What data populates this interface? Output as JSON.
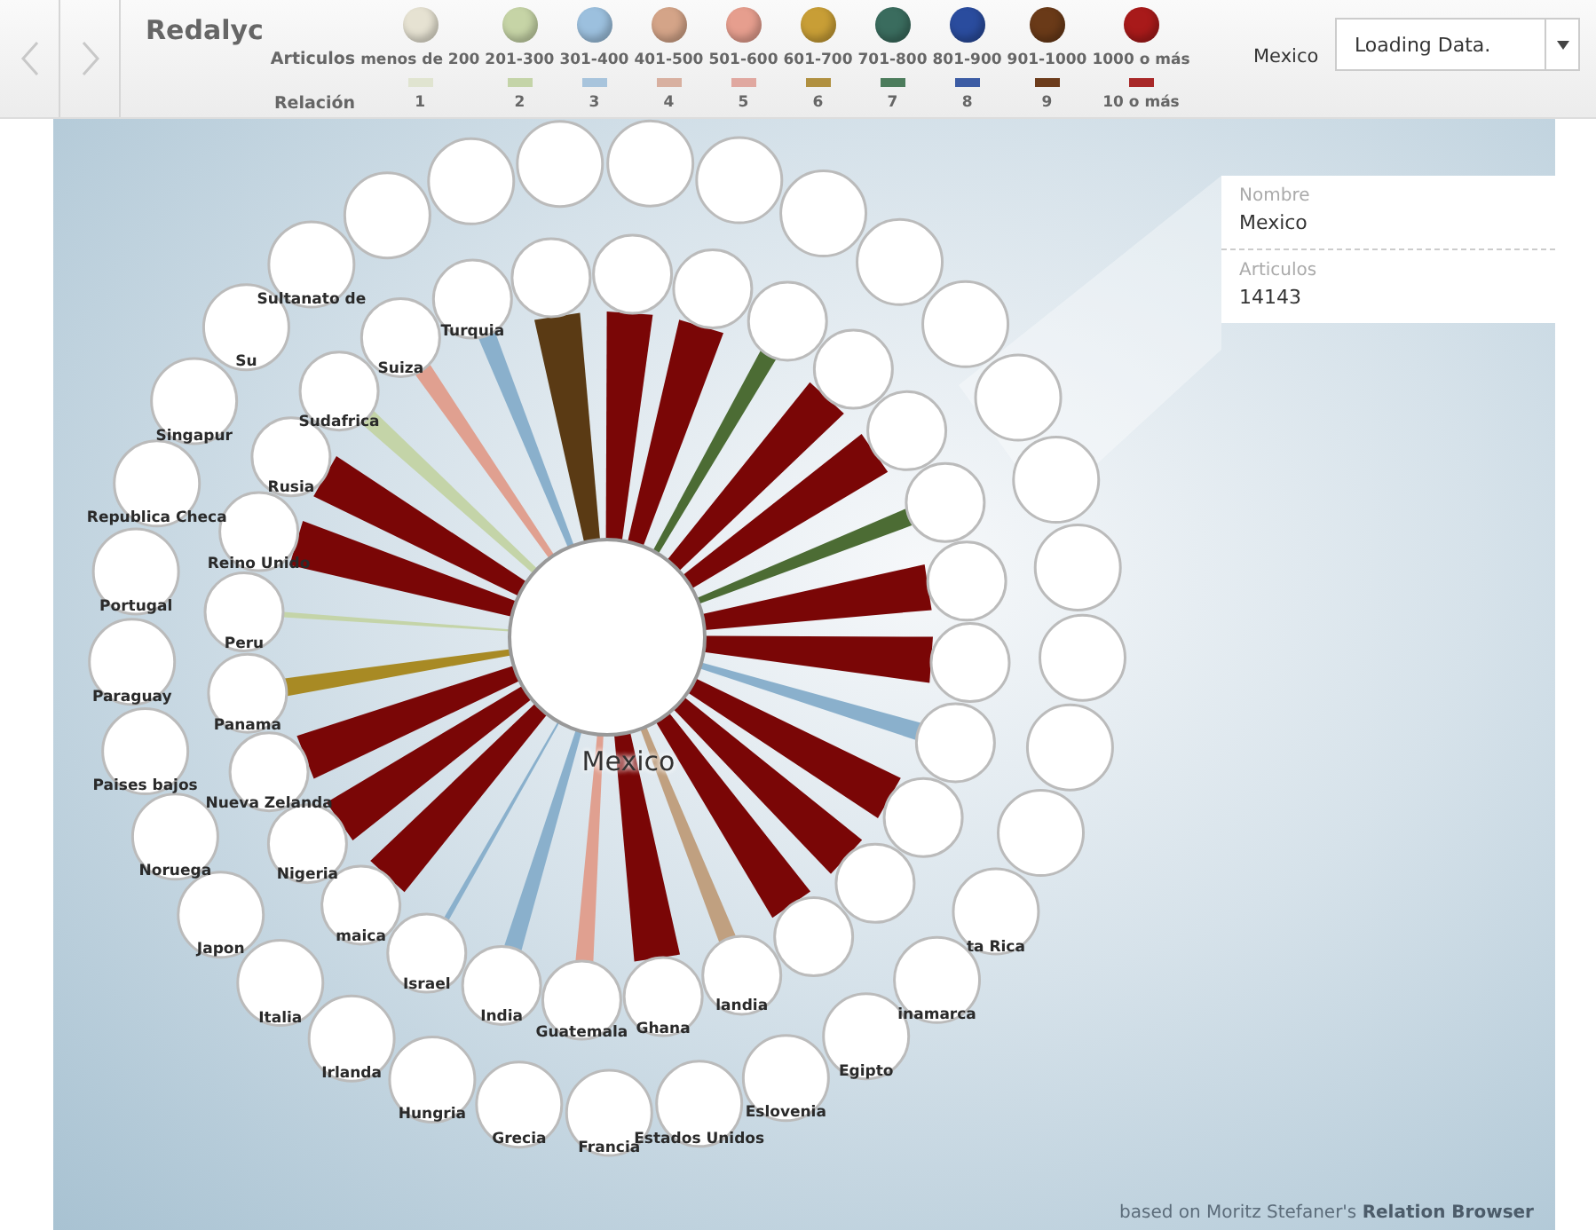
{
  "header": {
    "title": "Redalyc",
    "articulos_label": "Articulos",
    "relacion_label": "Relación",
    "articulos": [
      {
        "label": "menos de 200",
        "color": "#e6e2d2"
      },
      {
        "label": "201-300",
        "color": "#c6d4a6"
      },
      {
        "label": "301-400",
        "color": "#9cc0de"
      },
      {
        "label": "401-500",
        "color": "#d4a488"
      },
      {
        "label": "501-600",
        "color": "#e69e8e"
      },
      {
        "label": "601-700",
        "color": "#c89e36"
      },
      {
        "label": "701-800",
        "color": "#3a6c5e"
      },
      {
        "label": "801-900",
        "color": "#2a4c9e"
      },
      {
        "label": "901-1000",
        "color": "#6a3a18"
      },
      {
        "label": "1000 o más",
        "color": "#a81a1a"
      }
    ],
    "relacion": [
      {
        "label": "1",
        "color": "#e0e4d0"
      },
      {
        "label": "2",
        "color": "#c4d4a8"
      },
      {
        "label": "3",
        "color": "#a8c4dc"
      },
      {
        "label": "4",
        "color": "#d8b0a0"
      },
      {
        "label": "5",
        "color": "#e0a8a0"
      },
      {
        "label": "6",
        "color": "#b09040"
      },
      {
        "label": "7",
        "color": "#4c7c5c"
      },
      {
        "label": "8",
        "color": "#3c5ca4"
      },
      {
        "label": "9",
        "color": "#6c3c1c"
      },
      {
        "label": "10 o más",
        "color": "#a82828"
      }
    ],
    "search_label": "Mexico",
    "dropdown": {
      "value": "Loading Data."
    }
  },
  "graph": {
    "center": {
      "label": "Mexico"
    },
    "inner_ring": [
      {
        "color": "#7a0606",
        "kind": "strong"
      },
      {
        "color": "#5a3a14",
        "kind": "strong"
      },
      {
        "label": "Turquia",
        "color": "#8ab0cc",
        "kind": "medium"
      },
      {
        "label": "Suiza",
        "color": "#e0a090",
        "kind": "medium"
      },
      {
        "label": "Sudafrica",
        "color": "#c4d4a8",
        "kind": "medium"
      },
      {
        "label": "Rusia",
        "color": "#7a0606",
        "kind": "strong"
      },
      {
        "label": "Reino Unido",
        "color": "#7a0606",
        "kind": "strong"
      },
      {
        "label": "Peru",
        "color": "#c4d4a8",
        "kind": "thin"
      },
      {
        "label": "Panama",
        "color": "#a88a24",
        "kind": "medium"
      },
      {
        "label": "Nueva Zelanda",
        "color": "#7a0606",
        "kind": "strong"
      },
      {
        "label": "Nigeria",
        "color": "#7a0606",
        "kind": "strong"
      },
      {
        "label": "maica",
        "color": "#7a0606",
        "kind": "strong"
      },
      {
        "label": "Israel",
        "color": "#8ab0cc",
        "kind": "thin"
      },
      {
        "label": "India",
        "color": "#8ab0cc",
        "kind": "medium"
      },
      {
        "label": "Guatemala",
        "color": "#e0a090",
        "kind": "medium"
      },
      {
        "label": "Ghana",
        "color": "#7a0606",
        "kind": "strong"
      },
      {
        "label": "landia",
        "color": "#c0a080",
        "kind": "medium"
      },
      {
        "color": "#7a0606",
        "kind": "strong"
      },
      {
        "color": "#7a0606",
        "kind": "strong"
      },
      {
        "color": "#7a0606",
        "kind": "strong"
      },
      {
        "color": "#8ab0cc",
        "kind": "medium"
      },
      {
        "color": "#7a0606",
        "kind": "strong"
      },
      {
        "color": "#7a0606",
        "kind": "strong"
      },
      {
        "color": "#4c6c34",
        "kind": "medium"
      },
      {
        "color": "#7a0606",
        "kind": "strong"
      },
      {
        "color": "#7a0606",
        "kind": "strong"
      },
      {
        "color": "#4c6c34",
        "kind": "medium"
      },
      {
        "color": "#7a0606",
        "kind": "strong"
      }
    ],
    "outer_ring": [
      {
        "kind": "node"
      },
      {
        "kind": "node"
      },
      {
        "kind": "node"
      },
      {
        "kind": "node",
        "label": "Sultanato de"
      },
      {
        "kind": "node",
        "label": "Su"
      },
      {
        "kind": "node",
        "label": "Singapur"
      },
      {
        "kind": "node",
        "label": "Republica Checa"
      },
      {
        "kind": "node",
        "label": "Portugal"
      },
      {
        "kind": "node",
        "label": "Paraguay"
      },
      {
        "kind": "node",
        "label": "Paises bajos"
      },
      {
        "kind": "node",
        "label": "Noruega"
      },
      {
        "kind": "node",
        "label": "Japon"
      },
      {
        "kind": "node",
        "label": "Italia"
      },
      {
        "kind": "node",
        "label": "Irlanda"
      },
      {
        "kind": "node",
        "label": "Hungria"
      },
      {
        "kind": "node",
        "label": "Grecia"
      },
      {
        "kind": "node",
        "label": "Francia"
      },
      {
        "kind": "node",
        "label": "Estados Unidos"
      },
      {
        "kind": "node",
        "label": "Eslovenia"
      },
      {
        "kind": "node",
        "label": "Egipto"
      },
      {
        "kind": "node",
        "label": "inamarca"
      },
      {
        "kind": "node",
        "label": "ta Rica"
      },
      {
        "kind": "node"
      },
      {
        "kind": "node"
      },
      {
        "kind": "node"
      },
      {
        "kind": "node"
      },
      {
        "kind": "node"
      },
      {
        "kind": "node"
      },
      {
        "kind": "node"
      },
      {
        "kind": "node"
      },
      {
        "kind": "node"
      },
      {
        "kind": "node"
      },
      {
        "kind": "node"
      }
    ]
  },
  "info_panel": {
    "fields": [
      {
        "label": "Nombre",
        "value": "Mexico"
      },
      {
        "label": "Articulos",
        "value": "14143"
      }
    ]
  },
  "credit": "based on Moritz Stefaner's **Relation Browser**"
}
